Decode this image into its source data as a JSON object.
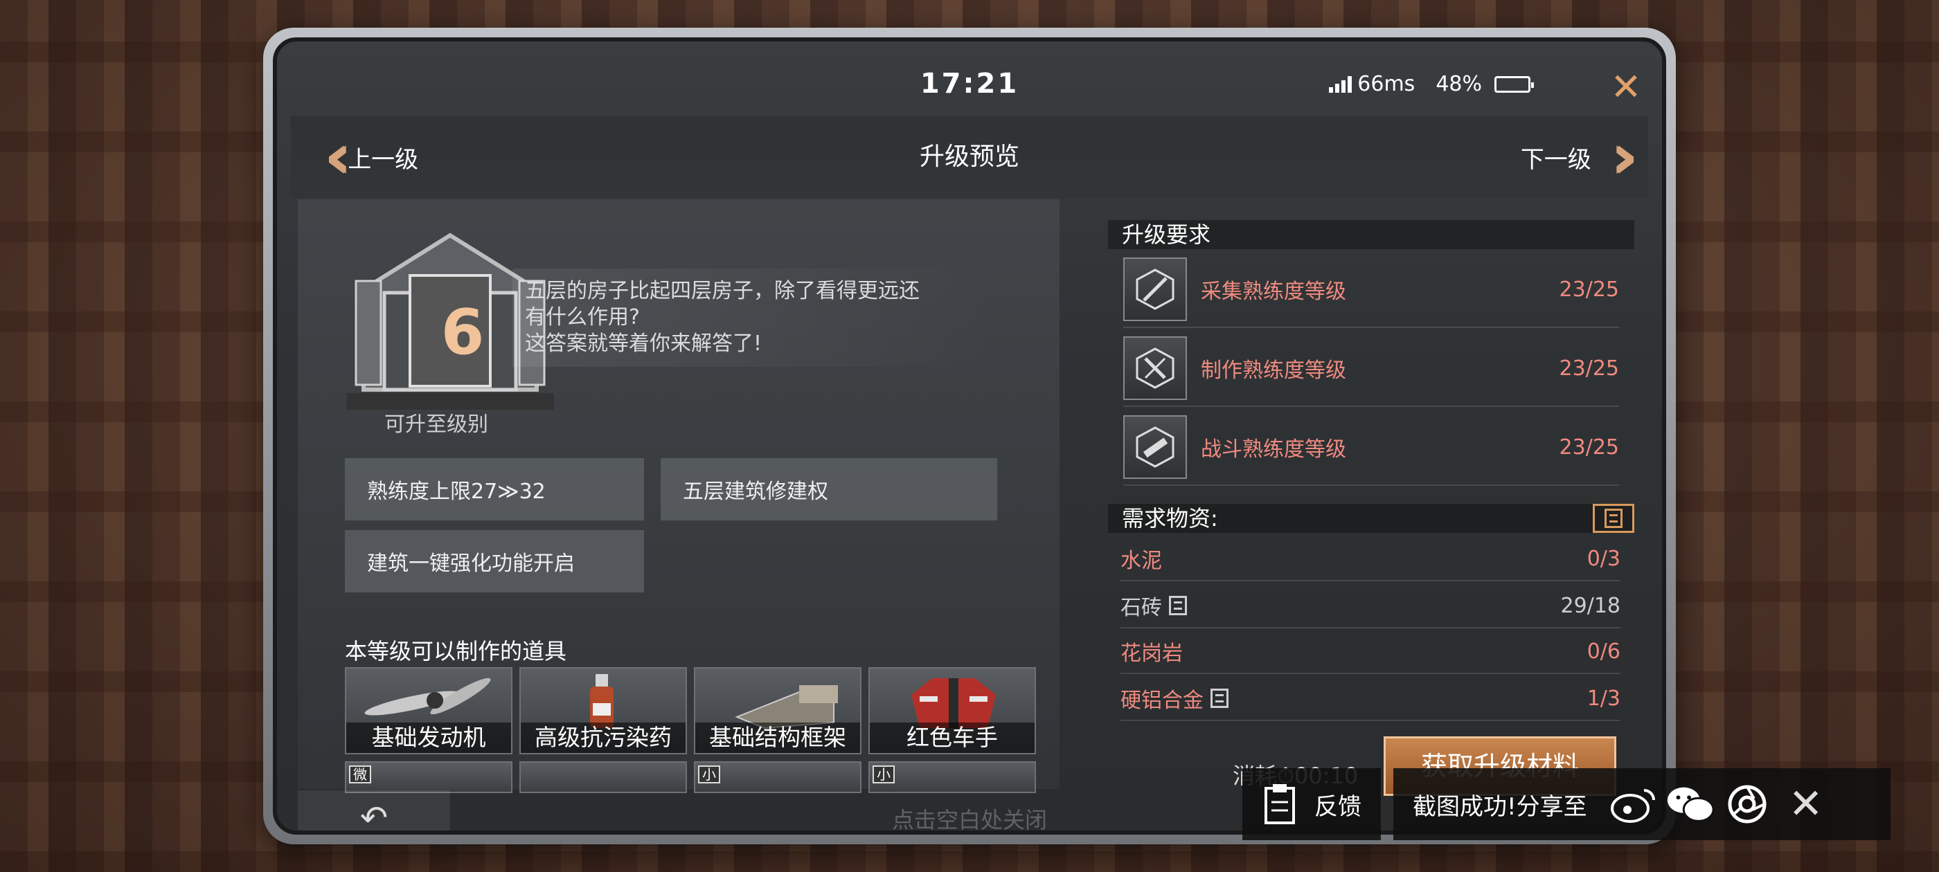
{
  "status": {
    "time": "17:21",
    "ping": "66ms",
    "battery": "48%",
    "battery_level": 0.48
  },
  "header": {
    "prev_label": "上一级",
    "title": "升级预览",
    "next_label": "下一级",
    "close_glyph": "✕"
  },
  "level": {
    "number": "6",
    "caption": "可升至级别",
    "description_line1": "五层的房子比起四层房子，除了看得更远还",
    "description_line2": "有什么作用?",
    "description_line3": "这答案就等着你来解答了!"
  },
  "perks": [
    "熟练度上限27≫32",
    "五层建筑修建权",
    "建筑一键强化功能开启"
  ],
  "craftables": {
    "title": "本等级可以制作的道具",
    "items": [
      {
        "label": "基础发动机"
      },
      {
        "label": "高级抗污染药"
      },
      {
        "label": "基础结构框架"
      },
      {
        "label": "红色车手"
      }
    ],
    "partial_tags": [
      "微",
      "",
      "小",
      "小"
    ]
  },
  "requirements": {
    "title": "升级要求",
    "rows": [
      {
        "label": "采集熟练度等级",
        "value": "23/25"
      },
      {
        "label": "制作熟练度等级",
        "value": "23/25"
      },
      {
        "label": "战斗熟练度等级",
        "value": "23/25"
      }
    ]
  },
  "materials": {
    "title": "需求物资:",
    "rows": [
      {
        "name": "水泥",
        "value": "0/3",
        "status": "insufficient"
      },
      {
        "name": "石砖",
        "value": "29/18",
        "status": "ok"
      },
      {
        "name": "花岗岩",
        "value": "0/6",
        "status": "insufficient"
      },
      {
        "name": "硬铝合金",
        "value": "1/3",
        "status": "insufficient"
      }
    ]
  },
  "cost": {
    "label": "消耗",
    "time": "00:10"
  },
  "actions": {
    "get_materials": "获取升级材料",
    "tap_to_close": "点击空白处关闭"
  },
  "share": {
    "feedback": "反馈",
    "message": "截图成功!分享至",
    "close_glyph": "✕"
  },
  "colors": {
    "accent": "#d7a37a",
    "warning": "#f08a80",
    "button": "#b87240"
  },
  "icons": [
    "signal-icon",
    "battery-icon",
    "close-icon",
    "back-arrow-icon",
    "weibo-icon",
    "wechat-icon",
    "camera-shutter-icon",
    "clipboard-icon",
    "storage-icon",
    "timer-icon"
  ]
}
